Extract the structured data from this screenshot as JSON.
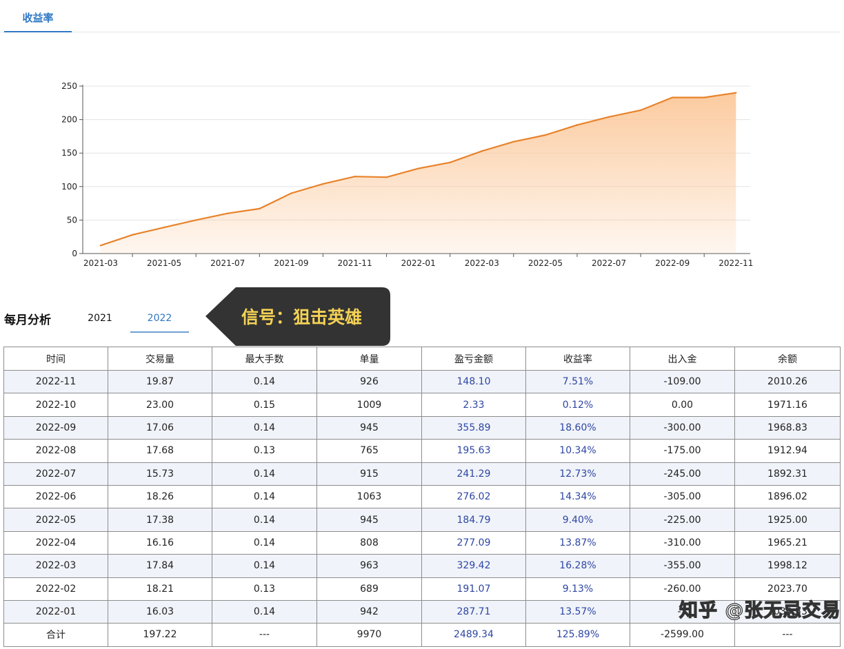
{
  "top_tab": {
    "label": "收益率"
  },
  "chart_data": {
    "type": "area",
    "title": "",
    "xlabel": "",
    "ylabel": "",
    "ylim": [
      0,
      250
    ],
    "yticks": [
      0,
      50,
      100,
      150,
      200,
      250
    ],
    "x_tick_labels": [
      "2021-03",
      "2021-05",
      "2021-07",
      "2021-09",
      "2021-11",
      "2022-01",
      "2022-03",
      "2022-05",
      "2022-07",
      "2022-09",
      "2022-11"
    ],
    "grid": true,
    "line_color": "#e8822a",
    "fill_color": "#fbc89a",
    "x": [
      "2021-03",
      "2021-04",
      "2021-05",
      "2021-06",
      "2021-07",
      "2021-08",
      "2021-09",
      "2021-10",
      "2021-11",
      "2021-12",
      "2022-01",
      "2022-02",
      "2022-03",
      "2022-04",
      "2022-05",
      "2022-06",
      "2022-07",
      "2022-08",
      "2022-09",
      "2022-10",
      "2022-11"
    ],
    "values": [
      12,
      28,
      39,
      50,
      60,
      67,
      90,
      104,
      115,
      114,
      127,
      136,
      153,
      167,
      177,
      192,
      204,
      214,
      233,
      233,
      240
    ]
  },
  "monthly": {
    "title": "每月分析",
    "years": [
      "2021",
      "2022"
    ],
    "selected_year": "2022"
  },
  "callout": {
    "text": "信号：狙击英雄"
  },
  "table": {
    "headers": [
      "时间",
      "交易量",
      "最大手数",
      "单量",
      "盈亏金额",
      "收益率",
      "出入金",
      "余额"
    ],
    "rows": [
      [
        "2022-11",
        "19.87",
        "0.14",
        "926",
        "148.10",
        "7.51%",
        "-109.00",
        "2010.26"
      ],
      [
        "2022-10",
        "23.00",
        "0.15",
        "1009",
        "2.33",
        "0.12%",
        "0.00",
        "1971.16"
      ],
      [
        "2022-09",
        "17.06",
        "0.14",
        "945",
        "355.89",
        "18.60%",
        "-300.00",
        "1968.83"
      ],
      [
        "2022-08",
        "17.68",
        "0.13",
        "765",
        "195.63",
        "10.34%",
        "-175.00",
        "1912.94"
      ],
      [
        "2022-07",
        "15.73",
        "0.14",
        "915",
        "241.29",
        "12.73%",
        "-245.00",
        "1892.31"
      ],
      [
        "2022-06",
        "18.26",
        "0.14",
        "1063",
        "276.02",
        "14.34%",
        "-305.00",
        "1896.02"
      ],
      [
        "2022-05",
        "17.38",
        "0.14",
        "945",
        "184.79",
        "9.40%",
        "-225.00",
        "1925.00"
      ],
      [
        "2022-04",
        "16.16",
        "0.14",
        "808",
        "277.09",
        "13.87%",
        "-310.00",
        "1965.21"
      ],
      [
        "2022-03",
        "17.84",
        "0.14",
        "963",
        "329.42",
        "16.28%",
        "-355.00",
        "1998.12"
      ],
      [
        "2022-02",
        "18.21",
        "0.13",
        "689",
        "191.07",
        "9.13%",
        "-260.00",
        "2023.70"
      ],
      [
        "2022-01",
        "16.03",
        "0.14",
        "942",
        "287.71",
        "13.57%",
        "-3",
        "2030.53"
      ]
    ],
    "total": [
      "合计",
      "197.22",
      "---",
      "9970",
      "2489.34",
      "125.89%",
      "-2599.00",
      "---"
    ]
  },
  "watermark": {
    "text": "知乎 @张无忌交易"
  }
}
